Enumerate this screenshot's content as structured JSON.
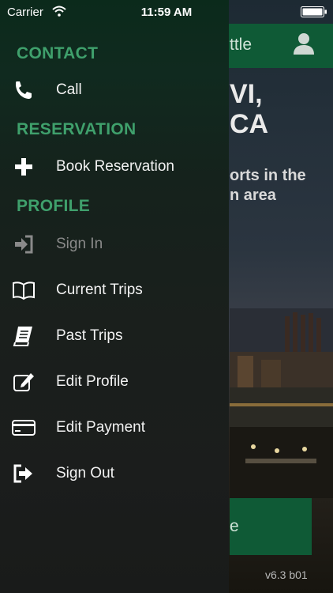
{
  "status_bar": {
    "carrier": "Carrier",
    "time": "11:59 AM"
  },
  "background_app": {
    "nav_title": "ttle",
    "headline_line1": "VI,",
    "headline_line2": "CA",
    "subheadline_line1": "orts in the",
    "subheadline_line2": "n area",
    "button_label": "e",
    "version": "v6.3  b01",
    "nav_color": "#0f5a36"
  },
  "drawer": {
    "accent_color": "#3fa06c",
    "sections": {
      "contact": "CONTACT",
      "reservation": "RESERVATION",
      "profile": "PROFILE"
    },
    "items": {
      "call": {
        "label": "Call",
        "icon": "phone-icon"
      },
      "book_reservation": {
        "label": "Book Reservation",
        "icon": "plus-icon"
      },
      "sign_in": {
        "label": "Sign In",
        "icon": "sign-in-icon"
      },
      "current_trips": {
        "label": "Current Trips",
        "icon": "open-book-icon"
      },
      "past_trips": {
        "label": "Past Trips",
        "icon": "book-icon"
      },
      "edit_profile": {
        "label": "Edit Profile",
        "icon": "edit-icon"
      },
      "edit_payment": {
        "label": "Edit Payment",
        "icon": "credit-card-icon"
      },
      "sign_out": {
        "label": "Sign Out",
        "icon": "sign-out-icon"
      }
    }
  }
}
